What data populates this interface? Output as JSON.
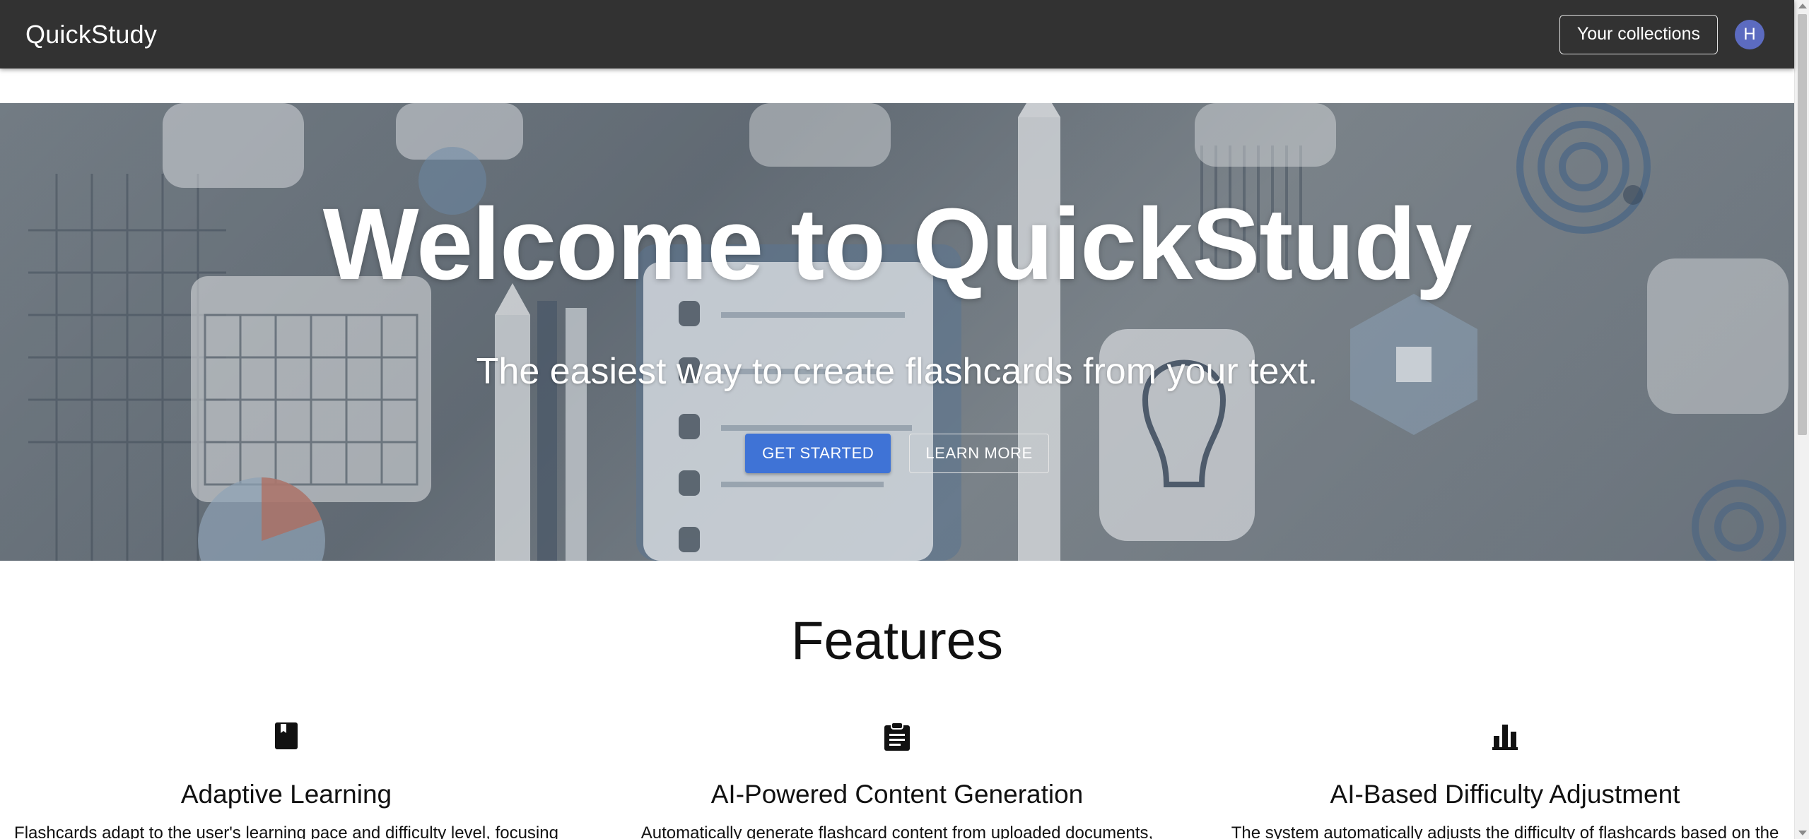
{
  "header": {
    "brand": "QuickStudy",
    "collections_label": "Your collections",
    "avatar_initial": "H"
  },
  "hero": {
    "title": "Welcome to QuickStudy",
    "subtitle": "The easiest way to create flashcards from your text.",
    "get_started_label": "GET STARTED",
    "learn_more_label": "LEARN MORE"
  },
  "features": {
    "title": "Features",
    "items": [
      {
        "icon": "book-icon",
        "title": "Adaptive Learning",
        "description": "Flashcards adapt to the user's learning pace and difficulty level, focusing"
      },
      {
        "icon": "clipboard-icon",
        "title": "AI-Powered Content Generation",
        "description": "Automatically generate flashcard content from uploaded documents,"
      },
      {
        "icon": "bar-chart-icon",
        "title": "AI-Based Difficulty Adjustment",
        "description": "The system automatically adjusts the difficulty of flashcards based on the"
      }
    ]
  },
  "colors": {
    "appbar": "#323232",
    "primary": "#3f73d6",
    "avatar": "#5c6bc0"
  }
}
